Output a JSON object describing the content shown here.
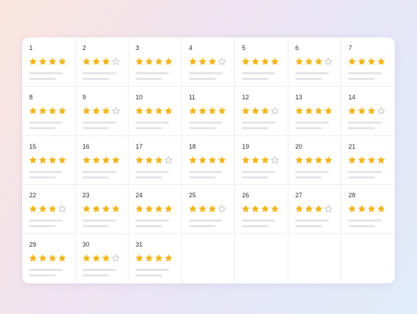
{
  "calendar": {
    "star_color": "#f2b51c",
    "empty_star_color": "#b9b9c2",
    "days": [
      {
        "day": "1",
        "rating": 4
      },
      {
        "day": "2",
        "rating": 3
      },
      {
        "day": "3",
        "rating": 4
      },
      {
        "day": "4",
        "rating": 3
      },
      {
        "day": "5",
        "rating": 4
      },
      {
        "day": "6",
        "rating": 3
      },
      {
        "day": "7",
        "rating": 4
      },
      {
        "day": "8",
        "rating": 4
      },
      {
        "day": "9",
        "rating": 3
      },
      {
        "day": "10",
        "rating": 4
      },
      {
        "day": "11",
        "rating": 4
      },
      {
        "day": "12",
        "rating": 3
      },
      {
        "day": "13",
        "rating": 4
      },
      {
        "day": "14",
        "rating": 3
      },
      {
        "day": "15",
        "rating": 4
      },
      {
        "day": "16",
        "rating": 4
      },
      {
        "day": "17",
        "rating": 3
      },
      {
        "day": "18",
        "rating": 4
      },
      {
        "day": "19",
        "rating": 3
      },
      {
        "day": "20",
        "rating": 4
      },
      {
        "day": "21",
        "rating": 4
      },
      {
        "day": "22",
        "rating": 3
      },
      {
        "day": "23",
        "rating": 4
      },
      {
        "day": "24",
        "rating": 4
      },
      {
        "day": "25",
        "rating": 3
      },
      {
        "day": "26",
        "rating": 4
      },
      {
        "day": "27",
        "rating": 3
      },
      {
        "day": "28",
        "rating": 4
      },
      {
        "day": "29",
        "rating": 4
      },
      {
        "day": "30",
        "rating": 3
      },
      {
        "day": "31",
        "rating": 4
      }
    ],
    "max_rating": 4,
    "total_cells": 35
  }
}
